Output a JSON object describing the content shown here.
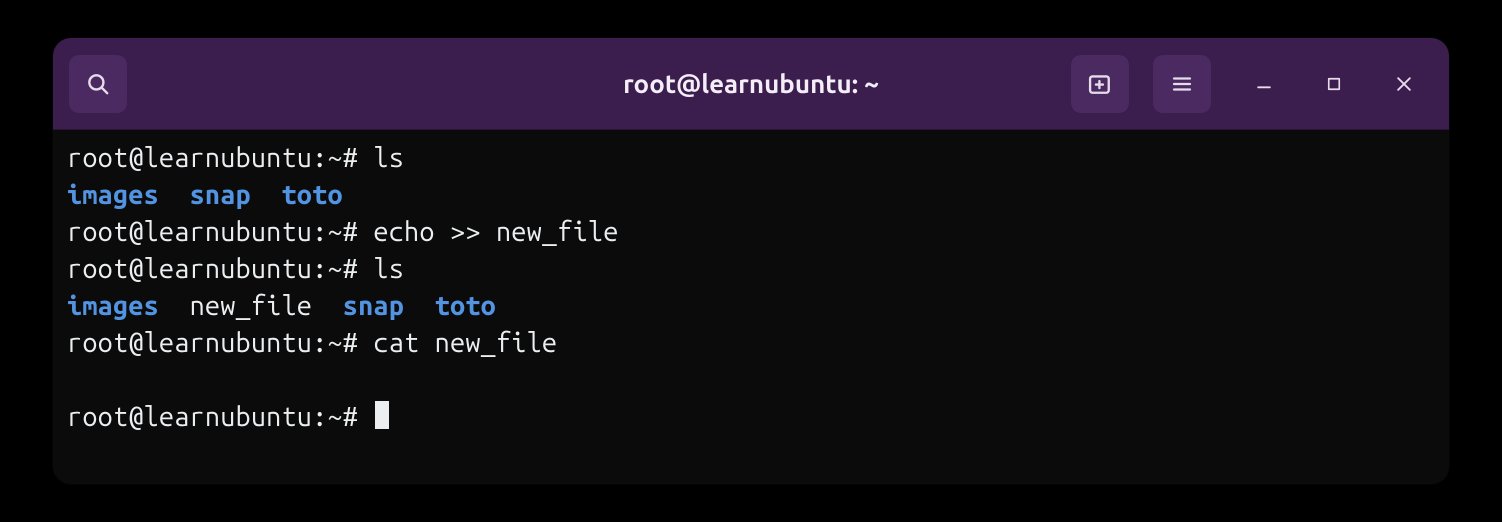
{
  "window": {
    "title": "root@learnubuntu: ~"
  },
  "prompt": "root@learnubuntu:~# ",
  "lines": [
    {
      "type": "cmd",
      "command": "ls"
    },
    {
      "type": "ls",
      "items": [
        {
          "name": "images",
          "kind": "dir"
        },
        {
          "name": "snap",
          "kind": "dir"
        },
        {
          "name": "toto",
          "kind": "dir"
        }
      ],
      "sep": "  "
    },
    {
      "type": "cmd",
      "command": "echo >> new_file"
    },
    {
      "type": "cmd",
      "command": "ls"
    },
    {
      "type": "ls",
      "items": [
        {
          "name": "images",
          "kind": "dir"
        },
        {
          "name": "new_file",
          "kind": "file"
        },
        {
          "name": "snap",
          "kind": "dir"
        },
        {
          "name": "toto",
          "kind": "dir"
        }
      ],
      "sep": "  "
    },
    {
      "type": "cmd",
      "command": "cat new_file"
    },
    {
      "type": "blank"
    },
    {
      "type": "prompt-cursor"
    }
  ]
}
